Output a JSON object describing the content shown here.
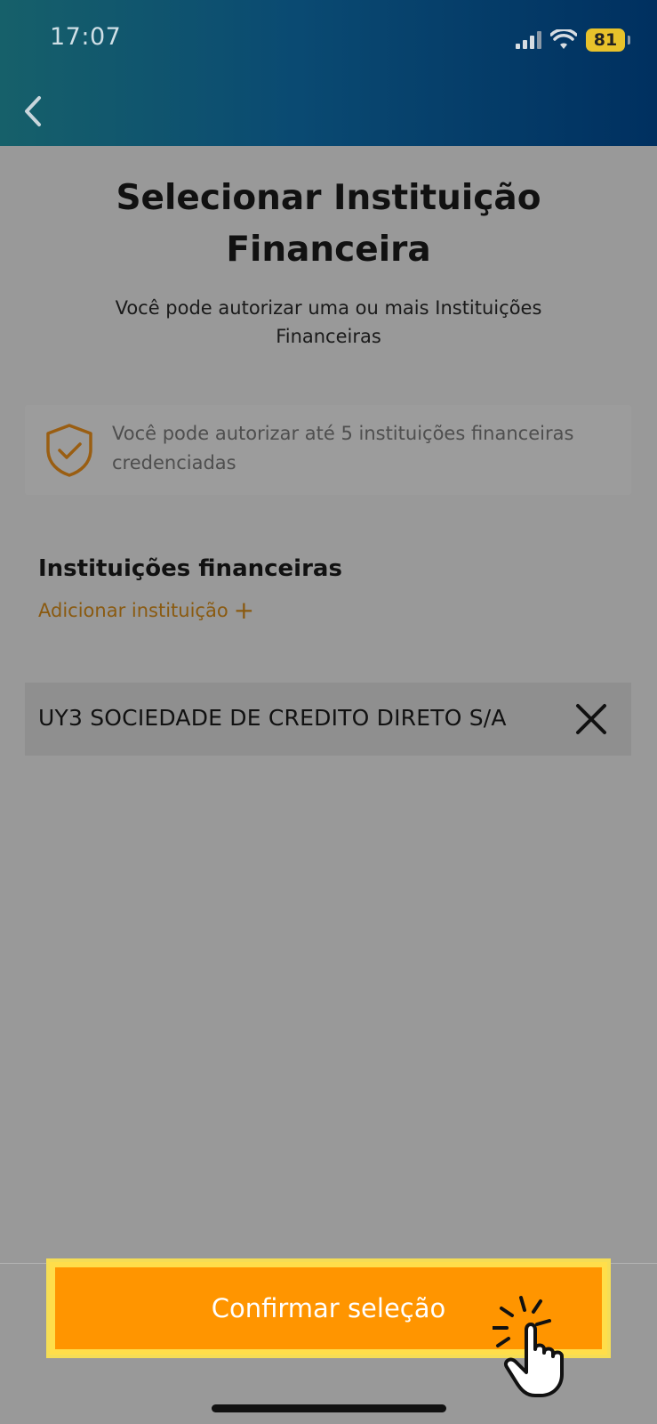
{
  "status_bar": {
    "time": "17:07",
    "battery": "81"
  },
  "header": {
    "back_icon": "chevron-left-icon"
  },
  "page": {
    "title": "Selecionar Instituição Financeira",
    "subtitle": "Você pode autorizar uma ou mais Instituições Financeiras"
  },
  "info_card": {
    "icon": "shield-check-icon",
    "text": "Você pode autorizar até 5 instituições financeiras credenciadas"
  },
  "section": {
    "title": "Instituições financeiras",
    "add_label": "Adicionar instituição",
    "add_symbol": "+"
  },
  "institutions": [
    {
      "name": "UY3 SOCIEDADE DE CREDITO DIRETO S/A"
    }
  ],
  "footer": {
    "confirm_label": "Confirmar seleção"
  },
  "colors": {
    "accent": "#ff9500",
    "highlight": "#ffde4a",
    "header_start": "#16606a",
    "header_end": "#003060"
  }
}
